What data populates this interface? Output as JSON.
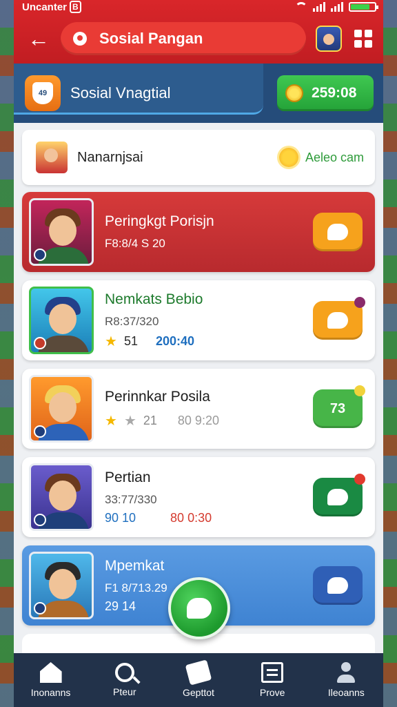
{
  "status_bar": {
    "carrier": "Uncanter",
    "badge": "B"
  },
  "header": {
    "title": "Sosial Pangan"
  },
  "subheader": {
    "title": "Sosial Vnagtial",
    "logo_text": "49",
    "coins": "259:08"
  },
  "notice": {
    "name": "Nanarnjsai",
    "status": "Aeleo cam"
  },
  "cards": [
    {
      "name": "Peringkgt Porisjn",
      "sub": "F8:8/4 S 20",
      "stat_a": "",
      "stat_b": "",
      "style": "red",
      "button_color": "#f6a21c"
    },
    {
      "name": "Nemkats Bebio",
      "sub": "R8:37/320",
      "stat_a": "51",
      "stat_b": "200:40",
      "style": "white",
      "button_color": "#f6a21c"
    },
    {
      "name": "Perinnkar Posila",
      "sub": "",
      "stat_a": "21",
      "stat_b": "80 9:20",
      "style": "white",
      "button_color": "#47b548",
      "button_text": "73"
    },
    {
      "name": "Pertian",
      "sub": "33:77/330",
      "stat_a": "90 10",
      "stat_b": "80 0:30",
      "style": "white",
      "button_color": "#1a8a43"
    },
    {
      "name": "Mpemkat",
      "sub": "F1 8/713.29",
      "stat_a": "29 14",
      "stat_b": "",
      "style": "blue",
      "button_color": "#2f5fb6"
    }
  ],
  "bottom_nav": [
    {
      "label": "Inonanns",
      "icon": "home-icon"
    },
    {
      "label": "Pteur",
      "icon": "search-icon"
    },
    {
      "label": "Gepttot",
      "icon": "gift-icon"
    },
    {
      "label": "Prove",
      "icon": "book-icon"
    },
    {
      "label": "Ileoanns",
      "icon": "user-icon"
    }
  ]
}
